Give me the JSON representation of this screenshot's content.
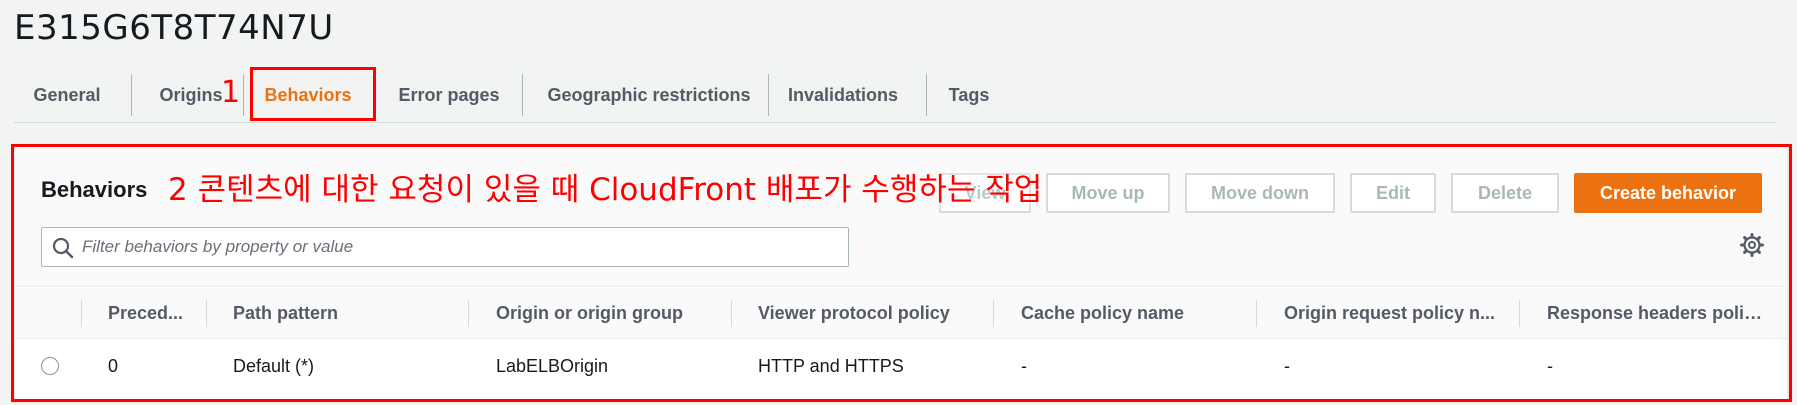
{
  "page": {
    "title": "E315G6T8T74N7U"
  },
  "tabs": [
    {
      "label": "General"
    },
    {
      "label": "Origins"
    },
    {
      "label": "Behaviors",
      "active": true
    },
    {
      "label": "Error pages"
    },
    {
      "label": "Geographic restrictions"
    },
    {
      "label": "Invalidations"
    },
    {
      "label": "Tags"
    }
  ],
  "annotations": {
    "step1": "1",
    "step2": "2 콘텐츠에 대한 요청이 있을 때 CloudFront 배포가 수행하는 작업"
  },
  "behaviors_panel": {
    "title": "Behaviors",
    "buttons": {
      "move_up": "Move up",
      "move_down": "Move down",
      "edit": "Edit",
      "delete": "Delete",
      "create": "Create behavior"
    },
    "search": {
      "placeholder": "Filter behaviors by property or value",
      "value": ""
    },
    "columns": [
      "Preced...",
      "Path pattern",
      "Origin or origin group",
      "Viewer protocol policy",
      "Cache policy name",
      "Origin request policy n...",
      "Response headers polic..."
    ],
    "rows": [
      [
        "0",
        "Default (*)",
        "LabELBOrigin",
        "HTTP and HTTPS",
        "-",
        "-",
        "-"
      ]
    ]
  },
  "colors": {
    "accent": "#ec7211",
    "annotation": "#ff0000"
  },
  "icons": {
    "search": "search-icon",
    "settings": "gear-icon"
  }
}
